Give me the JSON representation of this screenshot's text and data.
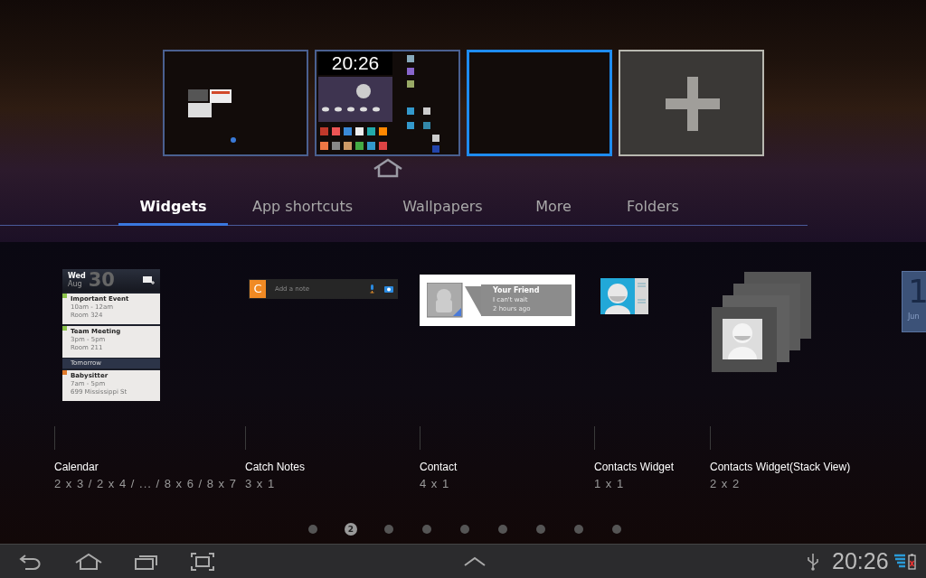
{
  "screens": [
    {
      "kind": "widgets",
      "selected": false
    },
    {
      "kind": "home",
      "clock": "20:26",
      "selected": false
    },
    {
      "kind": "empty",
      "selected": true
    },
    {
      "kind": "add",
      "selected": false
    }
  ],
  "tabs": [
    {
      "label": "Widgets",
      "selected": true
    },
    {
      "label": "App shortcuts",
      "selected": false
    },
    {
      "label": "Wallpapers",
      "selected": false
    },
    {
      "label": "More",
      "selected": false
    },
    {
      "label": "Folders",
      "selected": false
    }
  ],
  "widgets": [
    {
      "kind": "calendar",
      "name": "Calendar",
      "size": "2 x 3 / 2 x 4 / ... / 8 x 6 / 8 x 7",
      "preview": {
        "weekday": "Wed",
        "month": "Aug",
        "date": "30",
        "events": [
          {
            "title": "Important Event",
            "time": "10am - 12am",
            "place": "Room 324",
            "color": "#8bc34a"
          },
          {
            "title": "Team Meeting",
            "time": "3pm - 5pm",
            "place": "Room 211",
            "color": "#8bc34a"
          },
          {
            "heading": "Tomorrow"
          },
          {
            "title": "Babysitter",
            "time": "7am - 5pm",
            "place": "699 Mississippi St",
            "color": "#e07a2a"
          }
        ]
      }
    },
    {
      "kind": "note",
      "name": "Catch Notes",
      "size": "3 x 1",
      "preview": {
        "logo": "C",
        "placeholder": "Add a note"
      }
    },
    {
      "kind": "contact",
      "name": "Contact",
      "size": "4 x 1",
      "preview": {
        "name": "Your Friend",
        "message": "I can't wait",
        "time": "2 hours ago"
      }
    },
    {
      "kind": "contact-icon",
      "name": "Contacts Widget",
      "size": "1 x 1"
    },
    {
      "kind": "stack",
      "name": "Contacts Widget(Stack View)",
      "size": "2 x 2"
    }
  ],
  "next_widget": {
    "date": "1",
    "month": "Jun"
  },
  "pages": [
    {
      "selected": false
    },
    {
      "selected": true,
      "label": "2"
    },
    {
      "selected": false
    },
    {
      "selected": false
    },
    {
      "selected": false
    },
    {
      "selected": false
    },
    {
      "selected": false
    },
    {
      "selected": false
    },
    {
      "selected": false
    }
  ],
  "status_bar": {
    "time": "20:26"
  }
}
